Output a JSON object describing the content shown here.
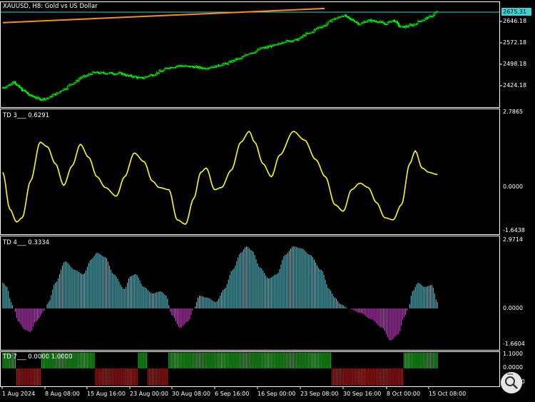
{
  "colors": {
    "background": "#000000",
    "frame": "#ffffff",
    "candle_up": "#00ff00",
    "candle_down": "#ff2020",
    "ma_line": "#ff8c1a",
    "price_line": "#3fd1d1",
    "td3_line": "#ffff00",
    "hist_pos": "#5fd3e0",
    "hist_neg": "#e040e0",
    "td7_pos": "#1fd21f",
    "td7_neg": "#d01a1a"
  },
  "main": {
    "symbol_title": "XAUUSD, H8:  Gold vs US Dollar",
    "current_price": "2675.31",
    "price_ticks": [
      "2646.18",
      "2572.18",
      "2498.18",
      "2424.18"
    ]
  },
  "td3": {
    "title": "TD 3___ 0.6291",
    "ticks": [
      "2.7865",
      "0.0000",
      "-1.6438"
    ]
  },
  "td4": {
    "title": "TD 4___ 0.3334",
    "ticks": [
      "2.9714",
      "0.0000",
      "-1.6604"
    ]
  },
  "td7": {
    "title": "TD 7___ 0.0000 1.0000",
    "ticks": [
      "1.1000",
      "0.0000",
      "-1.1000"
    ]
  },
  "time_axis": [
    "1 Aug 2024",
    "8 Aug 08:00",
    "15 Aug 16:00",
    "23 Aug 00:00",
    "30 Aug 08:00",
    "6 Sep 16:00",
    "16 Sep 00:00",
    "23 Sep 08:00",
    "30 Sep 16:00",
    "8 Oct 00:00",
    "15 Oct 08:00"
  ],
  "chart_data": {
    "type": "line",
    "price_anchors": [
      [
        0,
        2450
      ],
      [
        5,
        2458
      ],
      [
        8,
        2470
      ],
      [
        10,
        2455
      ],
      [
        15,
        2440
      ],
      [
        20,
        2425
      ],
      [
        27,
        2415
      ],
      [
        32,
        2418
      ],
      [
        38,
        2430
      ],
      [
        44,
        2445
      ],
      [
        50,
        2462
      ],
      [
        58,
        2482
      ],
      [
        66,
        2494
      ],
      [
        74,
        2493
      ],
      [
        84,
        2492
      ],
      [
        92,
        2484
      ],
      [
        100,
        2478
      ],
      [
        108,
        2488
      ],
      [
        114,
        2498
      ],
      [
        120,
        2510
      ],
      [
        128,
        2515
      ],
      [
        136,
        2512
      ],
      [
        145,
        2508
      ],
      [
        152,
        2512
      ],
      [
        160,
        2520
      ],
      [
        170,
        2535
      ],
      [
        180,
        2555
      ],
      [
        188,
        2568
      ],
      [
        196,
        2575
      ],
      [
        204,
        2588
      ],
      [
        212,
        2592
      ],
      [
        220,
        2610
      ],
      [
        230,
        2632
      ],
      [
        240,
        2655
      ],
      [
        246,
        2665
      ],
      [
        252,
        2652
      ],
      [
        258,
        2640
      ],
      [
        264,
        2650
      ],
      [
        270,
        2648
      ],
      [
        276,
        2640
      ],
      [
        282,
        2650
      ],
      [
        288,
        2630
      ],
      [
        296,
        2636
      ],
      [
        302,
        2650
      ],
      [
        308,
        2660
      ],
      [
        314,
        2675
      ]
    ],
    "td3_anchors": [
      [
        0,
        0.9
      ],
      [
        5,
        -0.8
      ],
      [
        10,
        -1.4
      ],
      [
        14,
        -1.2
      ],
      [
        20,
        0.5
      ],
      [
        27,
        2.3
      ],
      [
        32,
        2.1
      ],
      [
        38,
        1.3
      ],
      [
        44,
        0.3
      ],
      [
        50,
        1.2
      ],
      [
        56,
        2.2
      ],
      [
        62,
        1.6
      ],
      [
        68,
        0.7
      ],
      [
        74,
        0.2
      ],
      [
        82,
        -0.2
      ],
      [
        88,
        0.7
      ],
      [
        95,
        1.8
      ],
      [
        102,
        1.4
      ],
      [
        108,
        0.5
      ],
      [
        113,
        0.2
      ],
      [
        120,
        0.1
      ],
      [
        126,
        -1.3
      ],
      [
        132,
        -1.5
      ],
      [
        138,
        -0.3
      ],
      [
        143,
        0.9
      ],
      [
        147,
        1.1
      ],
      [
        153,
        0.1
      ],
      [
        158,
        0.2
      ],
      [
        165,
        1.0
      ],
      [
        172,
        2.3
      ],
      [
        178,
        2.8
      ],
      [
        182,
        2.3
      ],
      [
        188,
        1.3
      ],
      [
        194,
        0.7
      ],
      [
        200,
        1.7
      ],
      [
        210,
        2.8
      ],
      [
        218,
        2.4
      ],
      [
        226,
        1.5
      ],
      [
        233,
        0.7
      ],
      [
        240,
        -0.6
      ],
      [
        246,
        -0.9
      ],
      [
        252,
        0.1
      ],
      [
        258,
        0.4
      ],
      [
        264,
        0.2
      ],
      [
        270,
        -0.5
      ],
      [
        276,
        -1.2
      ],
      [
        282,
        -1.3
      ],
      [
        288,
        -0.6
      ],
      [
        294,
        1.3
      ],
      [
        298,
        1.9
      ],
      [
        303,
        1.1
      ],
      [
        308,
        0.9
      ],
      [
        314,
        0.8
      ]
    ],
    "td4_anchors": [
      [
        0,
        1.2
      ],
      [
        3,
        1.0
      ],
      [
        6,
        0.3
      ],
      [
        8,
        0.0
      ],
      [
        11,
        -0.6
      ],
      [
        16,
        -1.0
      ],
      [
        20,
        -1.1
      ],
      [
        24,
        -0.6
      ],
      [
        30,
        -0.1
      ],
      [
        33,
        0.3
      ],
      [
        38,
        1.2
      ],
      [
        45,
        2.2
      ],
      [
        52,
        1.8
      ],
      [
        58,
        1.6
      ],
      [
        64,
        2.3
      ],
      [
        68,
        2.6
      ],
      [
        74,
        2.4
      ],
      [
        80,
        1.6
      ],
      [
        88,
        0.9
      ],
      [
        92,
        1.5
      ],
      [
        96,
        1.6
      ],
      [
        102,
        1.0
      ],
      [
        108,
        0.7
      ],
      [
        114,
        0.8
      ],
      [
        118,
        0.6
      ],
      [
        122,
        -0.3
      ],
      [
        128,
        -0.9
      ],
      [
        134,
        -0.6
      ],
      [
        138,
        0.0
      ],
      [
        142,
        0.6
      ],
      [
        148,
        0.5
      ],
      [
        154,
        0.3
      ],
      [
        160,
        0.9
      ],
      [
        166,
        1.8
      ],
      [
        172,
        2.6
      ],
      [
        176,
        2.9
      ],
      [
        180,
        2.7
      ],
      [
        186,
        1.9
      ],
      [
        192,
        1.4
      ],
      [
        198,
        1.6
      ],
      [
        204,
        2.5
      ],
      [
        210,
        2.9
      ],
      [
        216,
        2.8
      ],
      [
        222,
        2.5
      ],
      [
        230,
        1.8
      ],
      [
        236,
        0.9
      ],
      [
        240,
        0.5
      ],
      [
        244,
        0.2
      ],
      [
        250,
        0.0
      ],
      [
        258,
        -0.2
      ],
      [
        266,
        -0.5
      ],
      [
        274,
        -0.9
      ],
      [
        280,
        -1.5
      ],
      [
        286,
        -1.2
      ],
      [
        290,
        -0.4
      ],
      [
        293,
        0.0
      ],
      [
        296,
        0.8
      ],
      [
        300,
        1.2
      ],
      [
        305,
        1.0
      ],
      [
        310,
        1.1
      ],
      [
        314,
        0.3
      ]
    ],
    "td7_segments": [
      [
        0,
        9,
        1
      ],
      [
        10,
        27,
        -1
      ],
      [
        28,
        66,
        1
      ],
      [
        67,
        97,
        -1
      ],
      [
        98,
        104,
        1
      ],
      [
        105,
        119,
        -1
      ],
      [
        120,
        237,
        1
      ],
      [
        238,
        289,
        -1
      ],
      [
        290,
        314,
        1
      ]
    ]
  }
}
